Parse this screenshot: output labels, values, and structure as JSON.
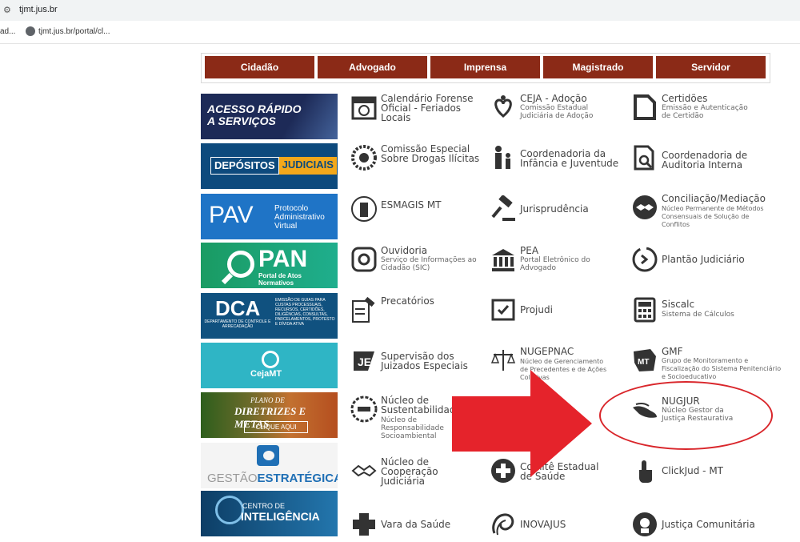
{
  "browser": {
    "url": "tjmt.jus.br",
    "bookmark_left": "ad...",
    "bookmark_right": "tjmt.jus.br/portal/cl..."
  },
  "nav": [
    "Cidadão",
    "Advogado",
    "Imprensa",
    "Magistrado",
    "Servidor"
  ],
  "banners": {
    "acesso": "ACESSO RÁPIDO A SERVIÇOS",
    "depositos_1": "DEPÓSITOS",
    "depositos_2": "JUDICIAIS",
    "pav_big": "PAV",
    "pav_sub": "Protocolo Administrativo Virtual",
    "pan_big": "PAN",
    "pan_sub": "Portal de Atos Normativos",
    "dca_big": "DCA",
    "dca_sub": "DEPARTAMENTO DE CONTROLE E ARRECADAÇÃO",
    "dca_txt": "EMISSÃO DE GUIAS PARA CUSTAS PROCESSUAIS, RECURSOS, CERTIDÕES, DILIGÊNCIAS, CONSULTAS, PARCELAMENTOS, PROTESTO E DÍVIDA ATIVA",
    "ceja": "CejaMT",
    "plano_1": "PLANO DE",
    "plano_2": "DIRETRIZES E METAS",
    "plano_btn": "CLIQUE AQUI",
    "gestao_1": "GESTÃO",
    "gestao_2": "ESTRATÉGICA",
    "centro_1": "CENTRO DE",
    "centro_2": "INTELIGÊNCIA"
  },
  "services": {
    "cal_t": "Calendário Forense Oficial - Feriados Locais",
    "ceja_t": "CEJA - Adoção",
    "ceja_s": "Comissão Estadual Judiciária de Adoção",
    "cert_t": "Certidões",
    "cert_s": "Emissão e Autenticação de Certidão",
    "drogas_t": "Comissão Especial Sobre Drogas Ilícitas",
    "infancia_t": "Coordenadoria da Infância e Juventude",
    "auditoria_t": "Coordenadoria de Auditoria Interna",
    "esmagis_t": "ESMAGIS MT",
    "juris_t": "Jurisprudência",
    "concil_t": "Conciliação/Mediação",
    "concil_s": "Núcleo Permanente de Métodos Consensuais de Solução de Conflitos",
    "ouv_t": "Ouvidoria",
    "ouv_s": "Serviço de Informações ao Cidadão (SIC)",
    "pea_t": "PEA",
    "pea_s": "Portal Eletrônico do Advogado",
    "plantao_t": "Plantão Judiciário",
    "prec_t": "Precatórios",
    "projudi_t": "Projudi",
    "siscalc_t": "Siscalc",
    "siscalc_s": "Sistema de Cálculos",
    "supervisao_t": "Supervisão dos Juizados Especiais",
    "nugepnac_t": "NUGEPNAC",
    "nugepnac_s": "Núcleo de Gerenciamento de Precedentes e de Ações Coletivas",
    "gmf_t": "GMF",
    "gmf_s": "Grupo de Monitoramento e Fiscalização do Sistema Penitenciário e Socioeducativo",
    "sust_t": "Núcleo de Sustentabilidade",
    "sust_s": "Núcleo de Responsabilidade Socioambiental",
    "nugjur_t": "NUGJUR",
    "nugjur_s": "Núcleo Gestor da Justiça Restaurativa",
    "coop_t": "Núcleo de Cooperação Judiciária",
    "saude_t": "Comitê Estadual de Saúde",
    "clickjud_t": "ClickJud - MT",
    "vara_t": "Vara da Saúde",
    "inovajus_t": "INOVAJUS",
    "comunit_t": "Justiça Comunitária"
  },
  "colors": {
    "nav_bg": "#8b2a17",
    "arrow": "#e5232b",
    "highlight": "#d9262b"
  }
}
